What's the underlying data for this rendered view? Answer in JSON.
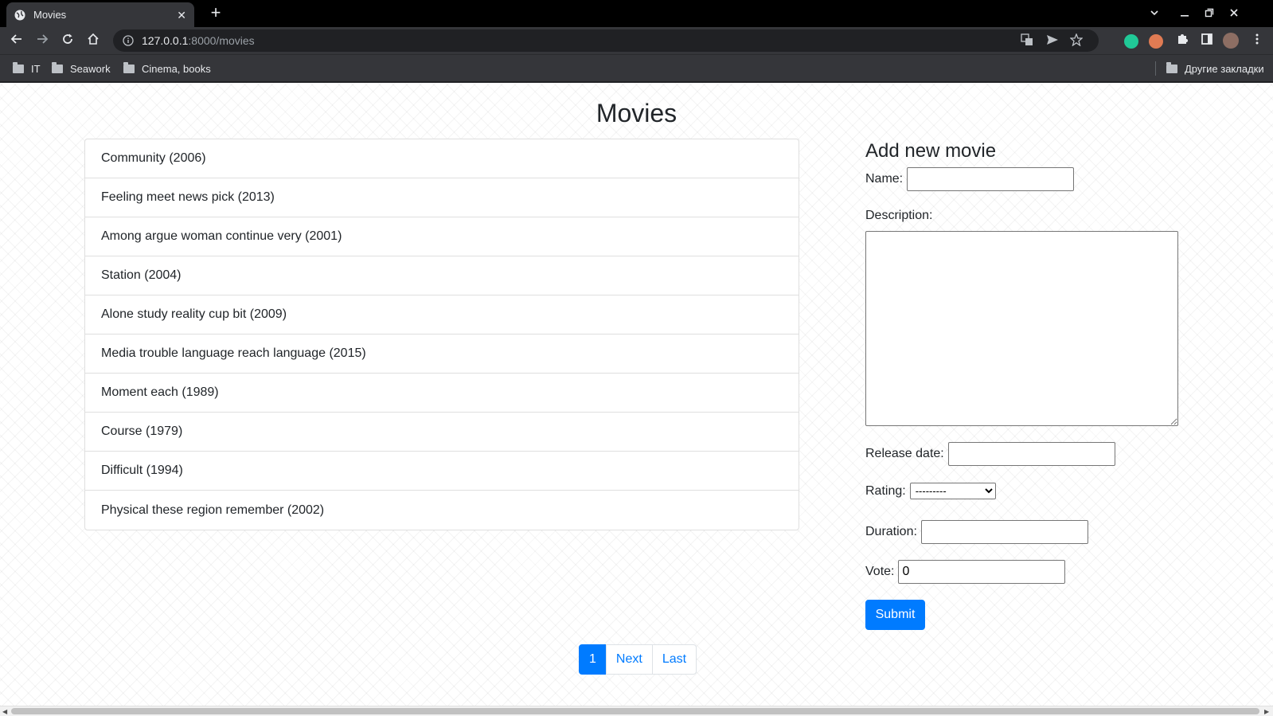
{
  "browser": {
    "tab_title": "Movies",
    "tab_close": "✕",
    "new_tab": "+",
    "url_host": "127.0.0.1",
    "url_path": ":8000/movies",
    "bookmarks": [
      "IT",
      "Seawork",
      "Cinema, books"
    ],
    "other_bookmarks": "Другие закладки"
  },
  "page": {
    "title": "Movies"
  },
  "movies": [
    "Community (2006)",
    "Feeling meet news pick (2013)",
    "Among argue woman continue very (2001)",
    "Station (2004)",
    "Alone study reality cup bit (2009)",
    "Media trouble language reach language (2015)",
    "Moment each (1989)",
    "Course (1979)",
    "Difficult (1994)",
    "Physical these region remember (2002)"
  ],
  "form": {
    "heading": "Add new movie",
    "name_label": "Name:",
    "name_value": "",
    "description_label": "Description:",
    "description_value": "",
    "release_label": "Release date:",
    "release_value": "",
    "rating_label": "Rating:",
    "rating_selected": "---------",
    "duration_label": "Duration:",
    "duration_value": "",
    "vote_label": "Vote:",
    "vote_value": "0",
    "submit_label": "Submit"
  },
  "pagination": {
    "current": "1",
    "next": "Next",
    "last": "Last"
  },
  "colors": {
    "primary": "#007bff",
    "chrome_dark": "#202124",
    "chrome_toolbar": "#35363a"
  }
}
